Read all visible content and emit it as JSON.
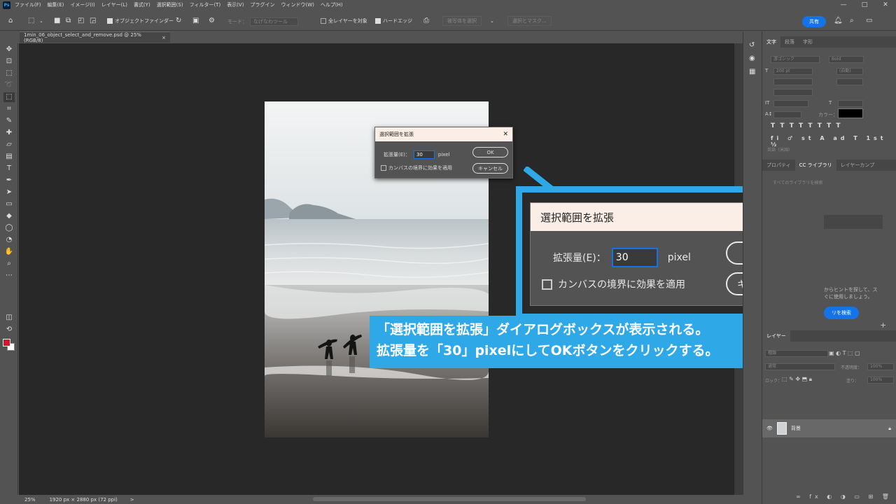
{
  "app": {
    "logo_text": "Ps",
    "menus": [
      "ファイル(F)",
      "編集(E)",
      "イメージ(I)",
      "レイヤー(L)",
      "書式(Y)",
      "選択範囲(S)",
      "フィルター(T)",
      "表示(V)",
      "プラグイン",
      "ウィンドウ(W)",
      "ヘルプ(H)"
    ],
    "window_controls": [
      "—",
      "□",
      "✕"
    ]
  },
  "options": {
    "object_finder": "オブジェクトファインダー",
    "mode_label": "モード：",
    "mode_value": "なげなわツール",
    "all_layers": "全レイヤーを対象",
    "hard_edge": "ハードエッジ",
    "subject_select": "被写体を選択",
    "select_mask": "選択とマスク...",
    "share": "共有"
  },
  "document": {
    "tab_title": "1min_06_object_select_and_remove.psd @ 25% (RGB/8)",
    "tab_close": "×"
  },
  "status": {
    "zoom": "25%",
    "size": "1920 px × 2880 px (72 ppi)",
    "arrow": ">"
  },
  "dialog": {
    "title": "選択範囲を拡張",
    "close": "✕",
    "expand_label": "拡張量(E)：",
    "expand_value": "30",
    "unit": "pixel",
    "ok": "OK",
    "cancel": "キャンセル",
    "canvas_bounds": "カンバスの境界に効果を適用"
  },
  "caption": {
    "line1": "「選択範囲を拡張」ダイアログボックスが表示される。",
    "line2": "拡張量を「30」pixelにしてOKボタンをクリックする。"
  },
  "panels": {
    "char_tabs": [
      "文字",
      "段落",
      "字形"
    ],
    "font_family": "游ゴシック",
    "font_style": "Bold",
    "font_size": "200 pt",
    "leading": "(自動)",
    "color_label": "カラー：",
    "text_color": "#000000",
    "lang": "英語（米国）",
    "mid_tabs": [
      "プロパティ",
      "CC ライブラリ",
      "レイヤーカンプ"
    ],
    "search_placeholder": "すべてのライブラリを検索",
    "hint_text": "からヒントを探して、ス",
    "hint_text2": "ぐに使用しましょう。",
    "library_search_btn": "リを検索",
    "layers_tab": "レイヤー",
    "kind": "種類",
    "normal": "通常",
    "opacity_label": "不透明度：",
    "opacity": "100%",
    "lock_label": "ロック：",
    "fill_label": "塗り：",
    "fill": "100%",
    "layer_name": "背景",
    "layer_icons": "∞ fx ◐ ◑ ▭ ⊞ 🗑"
  },
  "colors": {
    "accent": "#2fa8e8",
    "foreground_swatch": "#d3172e",
    "share_button": "#1473e6"
  }
}
